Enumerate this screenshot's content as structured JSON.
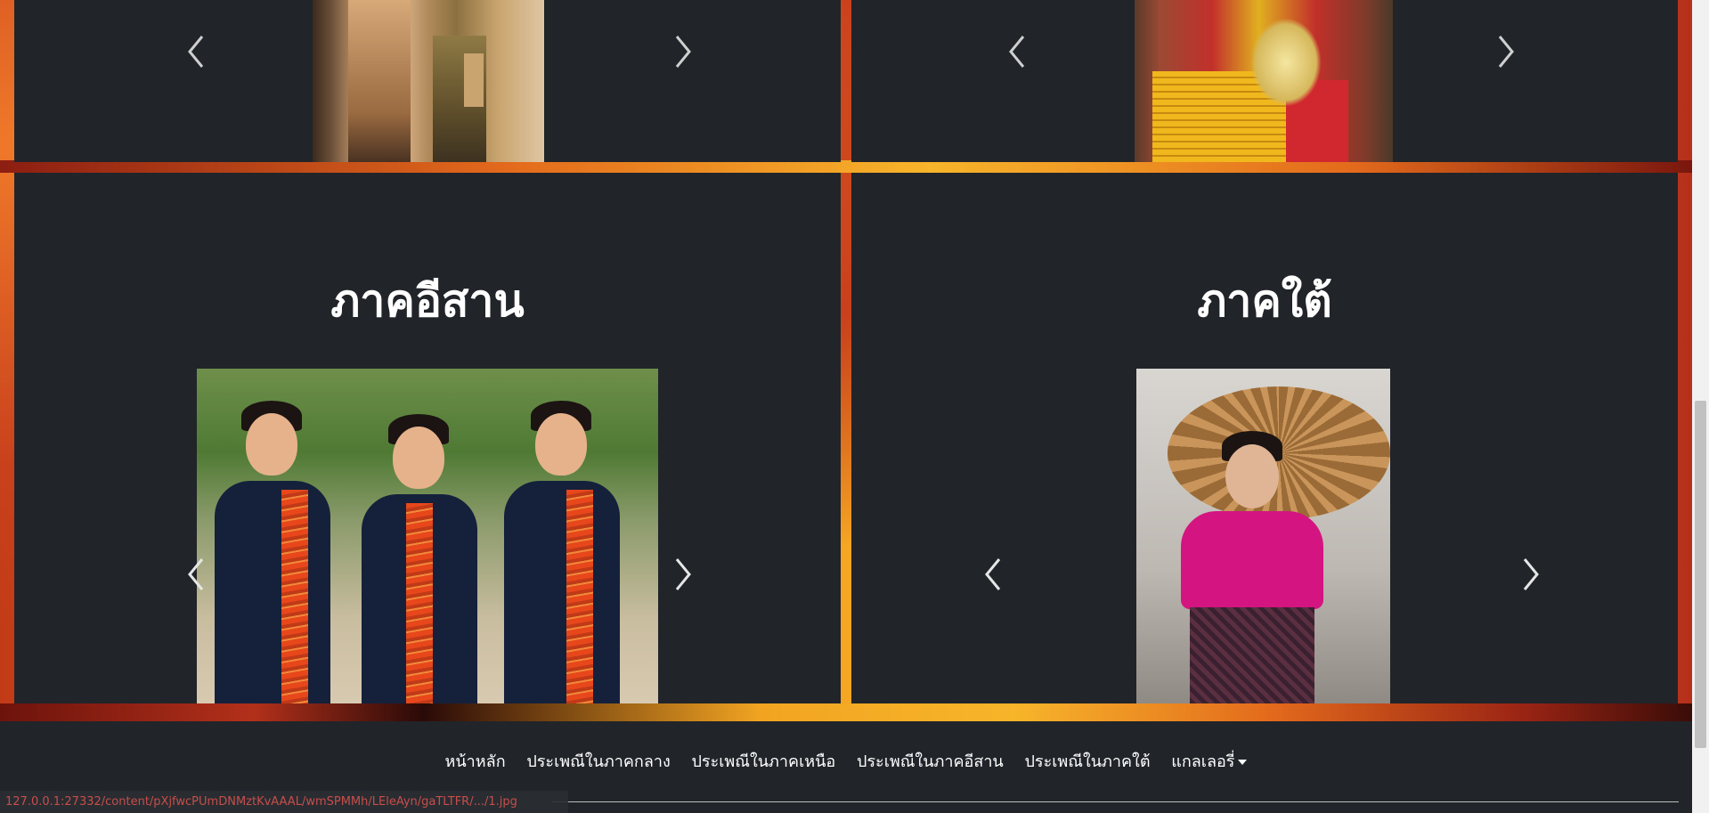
{
  "regions": {
    "isan": {
      "title": "ภาคอีสาน"
    },
    "south": {
      "title": "ภาคใต้"
    }
  },
  "carousel": {
    "prev_icon": "chevron-left-icon",
    "next_icon": "chevron-right-icon"
  },
  "nav": {
    "items": [
      "หน้าหลัก",
      "ประเพณีในภาคกลาง",
      "ประเพณีในภาคเหนือ",
      "ประเพณีในภาคอีสาน",
      "ประเพณีในภาคใต้"
    ],
    "dropdown_label": "แกลเลอรี่"
  },
  "status_bar": {
    "url": "127.0.0.1:27332/content/pXjfwcPUmDNMztKvAAAL/wmSPMMh/LEleAyn/gaTLTFR/.../1.jpg"
  },
  "colors": {
    "panel": "#212529",
    "accent": "#f5a623",
    "brand_red": "#c23b17"
  }
}
